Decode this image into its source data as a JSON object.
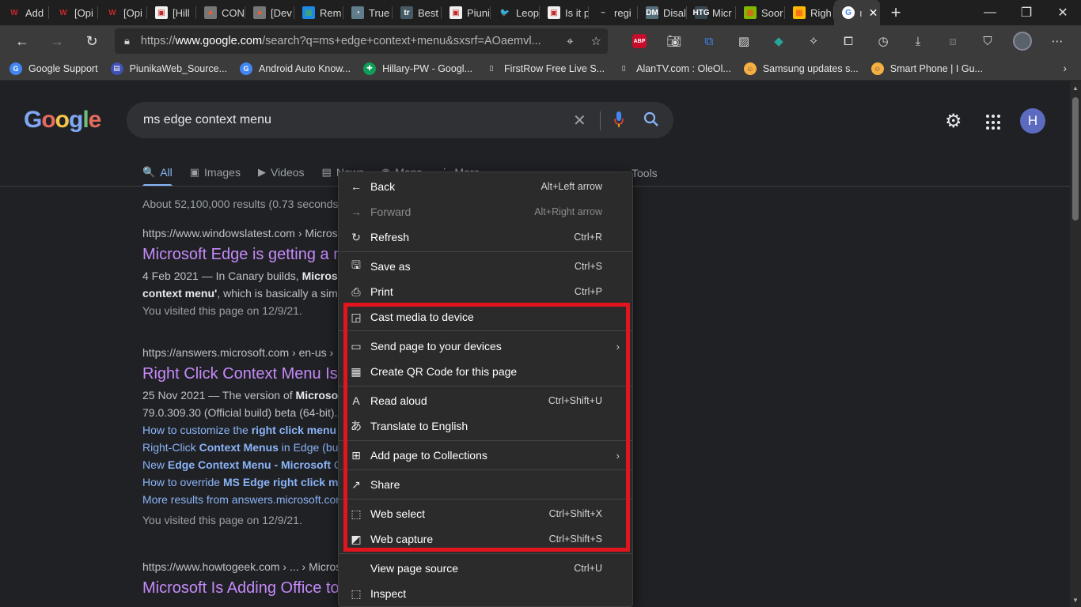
{
  "browser": {
    "tabs": [
      {
        "icon": "W",
        "color": "#c62828",
        "bg": "transparent",
        "label": "Add"
      },
      {
        "icon": "W",
        "color": "#c62828",
        "bg": "transparent",
        "label": "[Opi"
      },
      {
        "icon": "W",
        "color": "#c62828",
        "bg": "transparent",
        "label": "[Opi"
      },
      {
        "icon": "▣",
        "color": "#c62828",
        "bg": "#f0f0f0",
        "label": "[Hill"
      },
      {
        "icon": "●",
        "color": "#ff5722",
        "bg": "#777",
        "label": "CON"
      },
      {
        "icon": "●",
        "color": "#ff5722",
        "bg": "#777",
        "label": "[Dev"
      },
      {
        "icon": "▦",
        "color": "#4caf50",
        "bg": "#1e88e5",
        "label": "Rem"
      },
      {
        "icon": "◔",
        "color": "#fff",
        "bg": "#607d8b",
        "label": "True"
      },
      {
        "icon": "tr",
        "color": "#fff",
        "bg": "#455a64",
        "label": "Best"
      },
      {
        "icon": "▣",
        "color": "#c62828",
        "bg": "#f0f0f0",
        "label": "Piuni"
      },
      {
        "icon": "🐦",
        "color": "#1da1f2",
        "bg": "transparent",
        "label": "Leop"
      },
      {
        "icon": "▣",
        "color": "#c62828",
        "bg": "#f0f0f0",
        "label": "Is it p"
      },
      {
        "icon": "~",
        "color": "#bbb",
        "bg": "transparent",
        "label": "regi"
      },
      {
        "icon": "DM",
        "color": "#fff",
        "bg": "#546e7a",
        "label": "Disal"
      },
      {
        "icon": "HTG",
        "color": "#fff",
        "bg": "#37474f",
        "label": "Micr"
      },
      {
        "icon": "▦",
        "color": "#f25022",
        "bg": "#7fba00",
        "label": "Soor"
      },
      {
        "icon": "▦",
        "color": "#f25022",
        "bg": "#ffb900",
        "label": "Righ"
      }
    ],
    "active_tab": {
      "icon": "G",
      "label": "ı",
      "close": "✕"
    },
    "new_tab": "+",
    "window_buttons": {
      "minimize": "—",
      "restore": "❐",
      "close": "✕"
    },
    "address": {
      "prefix": "https://",
      "host": "www.google.com",
      "path": "/search?q=ms+edge+context+menu&sxsrf=AOaemvl..."
    },
    "favorites": [
      {
        "icon": "G",
        "color": "#fff",
        "bg": "#4285f4",
        "label": "Google Support"
      },
      {
        "icon": "▤",
        "color": "#fff",
        "bg": "#3f51b5",
        "label": "PiunikaWeb_Source..."
      },
      {
        "icon": "G",
        "color": "#fff",
        "bg": "#4285f4",
        "label": "Android Auto Know..."
      },
      {
        "icon": "✚",
        "color": "#fff",
        "bg": "#0f9d58",
        "label": "Hillary-PW - Googl..."
      },
      {
        "icon": "▯",
        "color": "#ddd",
        "bg": "transparent",
        "label": "FirstRow Free Live S..."
      },
      {
        "icon": "▯",
        "color": "#ddd",
        "bg": "transparent",
        "label": "AlanTV.com : OleOl..."
      },
      {
        "icon": "☺",
        "color": "#6d4c41",
        "bg": "#f5b041",
        "label": "Samsung updates s..."
      },
      {
        "icon": "☺",
        "color": "#6d4c41",
        "bg": "#f5b041",
        "label": "Smart Phone | I Gu..."
      }
    ],
    "favorites_more": "›"
  },
  "google": {
    "logo": [
      "G",
      "o",
      "o",
      "g",
      "l",
      "e"
    ],
    "query": "ms edge context menu",
    "tabs": [
      {
        "icon": "🔍",
        "label": "All",
        "active": true
      },
      {
        "icon": "▣",
        "label": "Images"
      },
      {
        "icon": "▶",
        "label": "Videos"
      },
      {
        "icon": "▤",
        "label": "News"
      },
      {
        "icon": "◉",
        "label": "Maps"
      },
      {
        "icon": "⋮",
        "label": "More"
      }
    ],
    "tools": "Tools",
    "avatar": "H",
    "stats": "About 52,100,000 results (0.73 seconds)",
    "results": [
      {
        "url": "https://www.windowslatest.com › Micros",
        "title": "Microsoft Edge is getting a n",
        "snippet_1_pre": "4 Feb 2021 — In Canary builds, ",
        "snippet_1_bold": "Micros",
        "snippet_2_bold": "context menu'",
        "snippet_2_post": ", which is basically a sim",
        "visited": "You visited this page on 12/9/21."
      },
      {
        "url": "https://answers.microsoft.com › en-us ›",
        "title": "Right Click Context Menu Is",
        "snippet_1_pre": "25 Nov 2021 — The version of ",
        "snippet_1_bold": "Microso",
        "snippet_2": "79.0.309.30 (Official build) beta (64-bit).",
        "links": [
          {
            "pre": "How to customize the ",
            "bold": "right click menu",
            "post": ""
          },
          {
            "pre": "Right-Click ",
            "bold": "Context Menus",
            "post": " in Edge (bu"
          },
          {
            "pre": "New ",
            "bold": "Edge Context Menu - Microsoft",
            "post": " C"
          },
          {
            "pre": "How to override ",
            "bold": "MS Edge right click m",
            "post": ""
          },
          {
            "pre": "More results from answers.microsoft.com",
            "bold": "",
            "post": ""
          }
        ],
        "visited": "You visited this page on 12/9/21."
      },
      {
        "url": "https://www.howtogeek.com › ... › Micros",
        "title": "Microsoft Is Adding Office to"
      }
    ]
  },
  "context_menu": {
    "items": [
      {
        "icon": "←",
        "label": "Back",
        "shortcut": "Alt+Left arrow",
        "disabled": false
      },
      {
        "icon": "→",
        "label": "Forward",
        "shortcut": "Alt+Right arrow",
        "disabled": true
      },
      {
        "icon": "↻",
        "label": "Refresh",
        "shortcut": "Ctrl+R",
        "disabled": false
      },
      {
        "icon": "🖫",
        "label": "Save as",
        "shortcut": "Ctrl+S",
        "disabled": false
      },
      {
        "icon": "⎙",
        "label": "Print",
        "shortcut": "Ctrl+P",
        "disabled": false
      },
      {
        "icon": "◲",
        "label": "Cast media to device",
        "shortcut": "",
        "disabled": false
      },
      {
        "icon": "▭",
        "label": "Send page to your devices",
        "shortcut": "",
        "submenu": true,
        "disabled": false
      },
      {
        "icon": "▦",
        "label": "Create QR Code for this page",
        "shortcut": "",
        "disabled": false
      },
      {
        "icon": "A",
        "label": "Read aloud",
        "shortcut": "Ctrl+Shift+U",
        "disabled": false
      },
      {
        "icon": "あ",
        "label": "Translate to English",
        "shortcut": "",
        "disabled": false
      },
      {
        "icon": "⊞",
        "label": "Add page to Collections",
        "shortcut": "",
        "submenu": true,
        "disabled": false
      },
      {
        "icon": "↗",
        "label": "Share",
        "shortcut": "",
        "disabled": false
      },
      {
        "icon": "⬚",
        "label": "Web select",
        "shortcut": "Ctrl+Shift+X",
        "disabled": false
      },
      {
        "icon": "◩",
        "label": "Web capture",
        "shortcut": "Ctrl+Shift+S",
        "disabled": false
      },
      {
        "icon": "",
        "label": "View page source",
        "shortcut": "Ctrl+U",
        "disabled": false
      },
      {
        "icon": "⬚",
        "label": "Inspect",
        "shortcut": "",
        "disabled": false
      }
    ],
    "highlight_color": "#e2141d"
  }
}
